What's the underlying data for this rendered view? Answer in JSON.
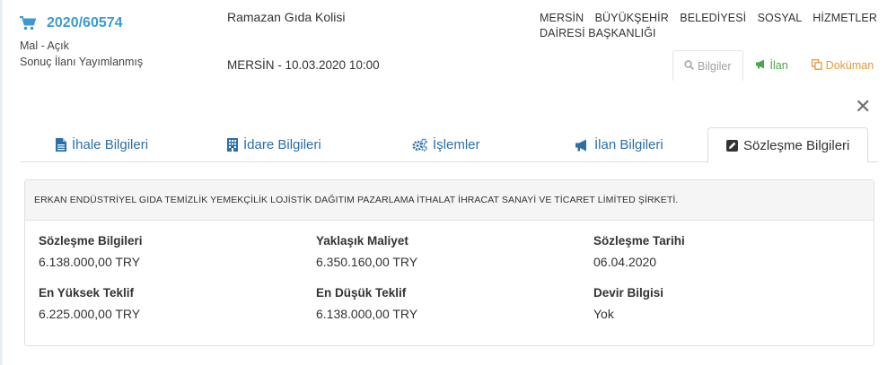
{
  "header": {
    "tender_id": "2020/60574",
    "status_type": "Mal - Açık",
    "status_result": "Sonuç İlanı Yayımlanmış",
    "tender_name": "Ramazan Gıda Kolisi",
    "location_date": "MERSİN - 10.03.2020 10:00",
    "authority": "MERSİN BÜYÜKŞEHİR BELEDİYESİ SOSYAL HİZMETLER DAİRESİ BAŞKANLIĞI",
    "actions": {
      "bilgiler": "Bilgiler",
      "ilan": "İlan",
      "dokuman": "Doküman"
    }
  },
  "tabs": [
    {
      "label": "İhale Bilgileri",
      "icon": "file-icon"
    },
    {
      "label": "İdare Bilgileri",
      "icon": "building-icon"
    },
    {
      "label": "İşlemler",
      "icon": "gears-icon"
    },
    {
      "label": "İlan Bilgileri",
      "icon": "bullhorn-icon"
    },
    {
      "label": "Sözleşme Bilgileri",
      "icon": "edit-icon",
      "active": true
    }
  ],
  "contract": {
    "company": "ERKAN ENDÜSTRİYEL GIDA TEMİZLİK YEMEKÇİLİK LOJİSTİK DAĞITIM PAZARLAMA İTHALAT İHRACAT SANAYİ VE TİCARET LİMİTED ŞİRKETİ.",
    "fields": [
      {
        "label": "Sözleşme Bilgileri",
        "value": "6.138.000,00 TRY"
      },
      {
        "label": "Yaklaşık Maliyet",
        "value": "6.350.160,00 TRY"
      },
      {
        "label": "Sözleşme Tarihi",
        "value": "06.04.2020"
      },
      {
        "label": "En Yüksek Teklif",
        "value": "6.225.000,00 TRY"
      },
      {
        "label": "En Düşük Teklif",
        "value": "6.138.000,00 TRY"
      },
      {
        "label": "Devir Bilgisi",
        "value": "Yok"
      }
    ]
  },
  "colors": {
    "link_blue": "#2a6fa8",
    "id_blue": "#3c9ad2",
    "ilan_green": "#4aa64a",
    "dokuman_orange": "#e59a3a"
  }
}
